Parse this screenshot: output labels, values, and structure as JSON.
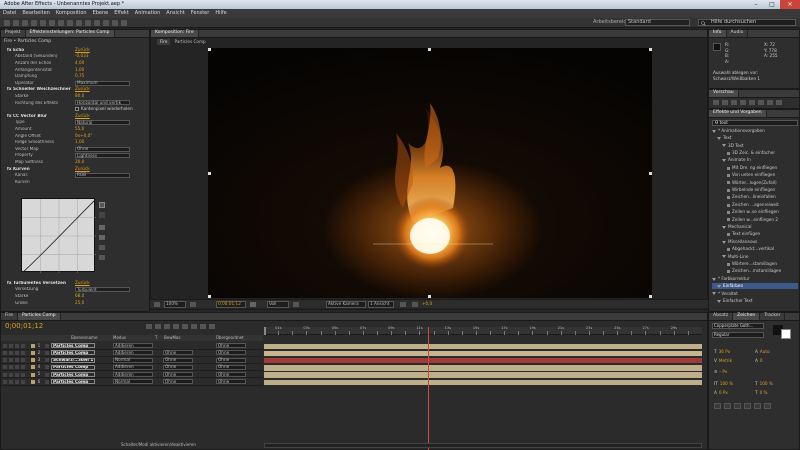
{
  "window": {
    "title": "Adobe After Effects - Unbenanntes Projekt.aep *",
    "minimize": "–",
    "maximize": "□",
    "close": "✕"
  },
  "menu": [
    "Datei",
    "Bearbeiten",
    "Komposition",
    "Ebene",
    "Effekt",
    "Animation",
    "Ansicht",
    "Fenster",
    "Hilfe"
  ],
  "toolbar": {
    "workspace_label": "Arbeitsbereich:",
    "workspace_value": "Standard",
    "search_placeholder": "Hilfe durchsuchen"
  },
  "left_panel": {
    "tabs": [
      "Projekt",
      "Effekteinstellungen: Particles Comp"
    ],
    "header": "Fire • Particles Comp",
    "rows": [
      {
        "label": "fx Echo",
        "val": "Zurück",
        "type": "fx"
      },
      {
        "label": "Abstand (Sekunden)",
        "val": "-0,033"
      },
      {
        "label": "Anzahl der Echos",
        "val": "4,00"
      },
      {
        "label": "Anfangsintensität",
        "val": "1,00"
      },
      {
        "label": "Dämpfung",
        "val": "0,75"
      },
      {
        "label": "Operator",
        "dd": "Maximum"
      },
      {
        "label": "fx Schneller Weichzeichner",
        "val": "Zurück",
        "type": "fx"
      },
      {
        "label": "Stärke",
        "val": "80,0"
      },
      {
        "label": "Richtung des Effekts",
        "dd": "Horizontal und vertik"
      },
      {
        "label": "",
        "check": "Kantenpixel wiederholen"
      },
      {
        "label": "fx CC Vector Blur",
        "val": "Zurück",
        "type": "fx"
      },
      {
        "label": "Type",
        "dd": "Natural"
      },
      {
        "label": "Amount",
        "val": "55,0"
      },
      {
        "label": "Angle Offset",
        "val": "0x+0,0°"
      },
      {
        "label": "Ridge Smoothness",
        "val": "1,00"
      },
      {
        "label": "Vector Map",
        "dd": "Ohne"
      },
      {
        "label": "Property",
        "dd": "Lightness"
      },
      {
        "label": "Map Softness",
        "val": "20,0"
      },
      {
        "label": "fx Kurven",
        "val": "Zurück",
        "type": "fx"
      },
      {
        "label": "Kanal:",
        "dd": "RGB"
      },
      {
        "label": "Kurven",
        "val": ""
      }
    ],
    "bottom_rows": [
      {
        "label": "fx Turbulentes Versetzen",
        "val": "Zurück",
        "type": "fx"
      },
      {
        "label": "Versetzung",
        "dd": "Turbulent"
      },
      {
        "label": "Stärke",
        "val": "68,0"
      },
      {
        "label": "Größe",
        "val": "25,0"
      }
    ]
  },
  "comp_panel": {
    "tab": "Komposition: Fire",
    "subtab_fire": "Fire",
    "subtab_particles": "Particles Comp"
  },
  "viewer_bar": {
    "zoom": "100%",
    "time": "0;00;01;12",
    "res": "Voll",
    "camera": "Aktive Kamera",
    "views": "1 Ansicht",
    "offset": "+0,0"
  },
  "info_panel": {
    "tabs": [
      "Info",
      "Audio"
    ],
    "r": "R:",
    "g": "G:",
    "b": "B:",
    "a": "A:",
    "x": "X: 72",
    "y": "Y: 778",
    "a_val": "A: 255",
    "line1": "Auswahl ablegen vor:",
    "line2": "Schwarz/Weißbalken 1"
  },
  "preview_tab": "Vorschau",
  "effects_panel": {
    "tab": "Effekte und Vorgaben",
    "search": "Ɵ text",
    "rows": [
      {
        "t": "* Animationsvorgaben",
        "d": 0
      },
      {
        "t": "Text",
        "d": 1
      },
      {
        "t": "3D Text",
        "d": 2
      },
      {
        "t": "3D Zeic. & einfacher",
        "d": 3
      },
      {
        "t": "Animate In",
        "d": 2
      },
      {
        "t": "Mit Dre. ng einfliegen",
        "d": 3
      },
      {
        "t": "Von unten einfliegen",
        "d": 3
      },
      {
        "t": "Wörter...lugen(Zufall)",
        "d": 3
      },
      {
        "t": "Wirbelnde einfliegen",
        "d": 3
      },
      {
        "t": "Zeichen...lineinfallen",
        "d": 3
      },
      {
        "t": "Zeichen ...agenreiweit",
        "d": 3
      },
      {
        "t": "Zeilen w..se einfliegen",
        "d": 3
      },
      {
        "t": "Zeilen w...einfliegen 2",
        "d": 3
      },
      {
        "t": "Mechanical",
        "d": 2
      },
      {
        "t": "Text einfügen",
        "d": 3
      },
      {
        "t": "Miscellaneous",
        "d": 2
      },
      {
        "t": "Abgehackt...vertikal",
        "d": 3
      },
      {
        "t": "Multi-Line",
        "d": 2
      },
      {
        "t": "Wörtere...stamillagen",
        "d": 3
      },
      {
        "t": "Zeichen...mstamillagen",
        "d": 3
      },
      {
        "t": "* Farbkorrektur",
        "d": 0
      },
      {
        "t": "Einfärben",
        "d": 1,
        "sel": true
      },
      {
        "t": "* Veraltet",
        "d": 0
      },
      {
        "t": "Einfacher Text",
        "d": 1
      }
    ]
  },
  "timeline": {
    "tabs": [
      "Fire",
      "Particles Comp"
    ],
    "time": "0;00;01;12",
    "col_headers": {
      "name": "Ebenenname",
      "mode": "Modus",
      "t": "T",
      "trkmat": "BewMas",
      "parent": "Übergeordnet"
    },
    "layers": [
      {
        "num": "1",
        "name": "Particles Comp",
        "mode": "Addieren",
        "t": "",
        "par": "Ohne",
        "bar": "#bfae8a"
      },
      {
        "num": "2",
        "name": "Particles Comp",
        "mode": "Addieren",
        "t": "Ohne",
        "par": "Ohne",
        "bar": "#c7b48c"
      },
      {
        "num": "3",
        "name": "Schwarz/...lken 1",
        "mode": "Normal",
        "t": "Ohne",
        "par": "Ohne",
        "bar": "#9e3a3a"
      },
      {
        "num": "4",
        "name": "Particles Comp",
        "mode": "Addieren",
        "t": "Ohne",
        "par": "Ohne",
        "bar": "#bfae8a"
      },
      {
        "num": "5",
        "name": "Particles Comp",
        "mode": "Addieren",
        "t": "Ohne",
        "par": "Ohne",
        "bar": "#bfae8a"
      },
      {
        "num": "6",
        "name": "Particles Comp",
        "mode": "Normal",
        "t": "Ohne",
        "par": "Ohne",
        "bar": "#bfae8a"
      }
    ],
    "ticks": [
      "01s",
      "02s",
      "03s",
      "04s",
      "05s",
      "06s",
      "07s",
      "08s",
      "09s",
      "10s",
      "11s",
      "12s",
      "13s",
      "14s",
      "15s",
      "16s",
      "17s",
      "18s",
      "19s",
      "20s",
      "21s",
      "22s",
      "23s",
      "24s",
      "25s",
      "26s",
      "27s",
      "28s",
      "29s",
      "30s"
    ],
    "playhead_fraction": 0.375,
    "footer": "Schalter/Modi aktivieren/deaktivieren"
  },
  "paragraph_panel": {
    "tabs": [
      "Absatz",
      "Zeichen",
      "Tracker"
    ],
    "font": "Copperplate Goth...",
    "style": "Regular",
    "size": "36 Px",
    "leading": "Auto",
    "kerning": "Metrik",
    "tracking": "0",
    "vscale": "100 %",
    "hscale": "100 %",
    "baseline": "0 Px",
    "tsume": "0 %",
    "px_label": "- Px"
  },
  "colors": {
    "accent": "#d9a21e",
    "selection": "#3d5a8a",
    "playhead": "#d04a3a",
    "layer_bar": "#bfae8a",
    "solid_bar": "#9e3a3a"
  }
}
